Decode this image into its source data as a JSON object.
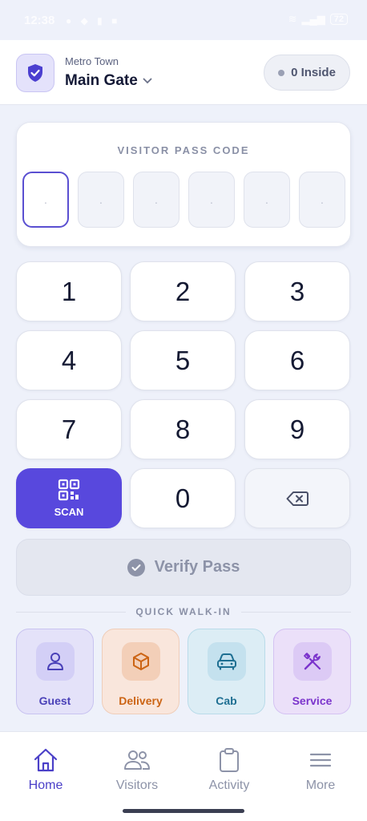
{
  "status_bar": {
    "time": "12:38",
    "battery": "72"
  },
  "header": {
    "site_sub": "Metro Town",
    "site_main": "Main Gate",
    "inside_label": "0 Inside"
  },
  "pass": {
    "title": "VISITOR PASS CODE",
    "digits": [
      ".",
      ".",
      ".",
      ".",
      ".",
      "."
    ]
  },
  "keypad": {
    "keys": [
      "1",
      "2",
      "3",
      "4",
      "5",
      "6",
      "7",
      "8",
      "9",
      "0"
    ],
    "scan_label": "SCAN"
  },
  "verify_label": "Verify Pass",
  "walkin": {
    "title": "QUICK WALK-IN",
    "tiles": [
      {
        "label": "Guest",
        "icon": "person-icon"
      },
      {
        "label": "Delivery",
        "icon": "box-icon"
      },
      {
        "label": "Cab",
        "icon": "car-icon"
      },
      {
        "label": "Service",
        "icon": "tools-icon"
      }
    ]
  },
  "nav": {
    "items": [
      {
        "label": "Home",
        "icon": "home-icon"
      },
      {
        "label": "Visitors",
        "icon": "users-icon"
      },
      {
        "label": "Activity",
        "icon": "clipboard-icon"
      },
      {
        "label": "More",
        "icon": "menu-icon"
      }
    ]
  },
  "colors": {
    "accent": "#5848dd",
    "background": "#eef1fa"
  }
}
